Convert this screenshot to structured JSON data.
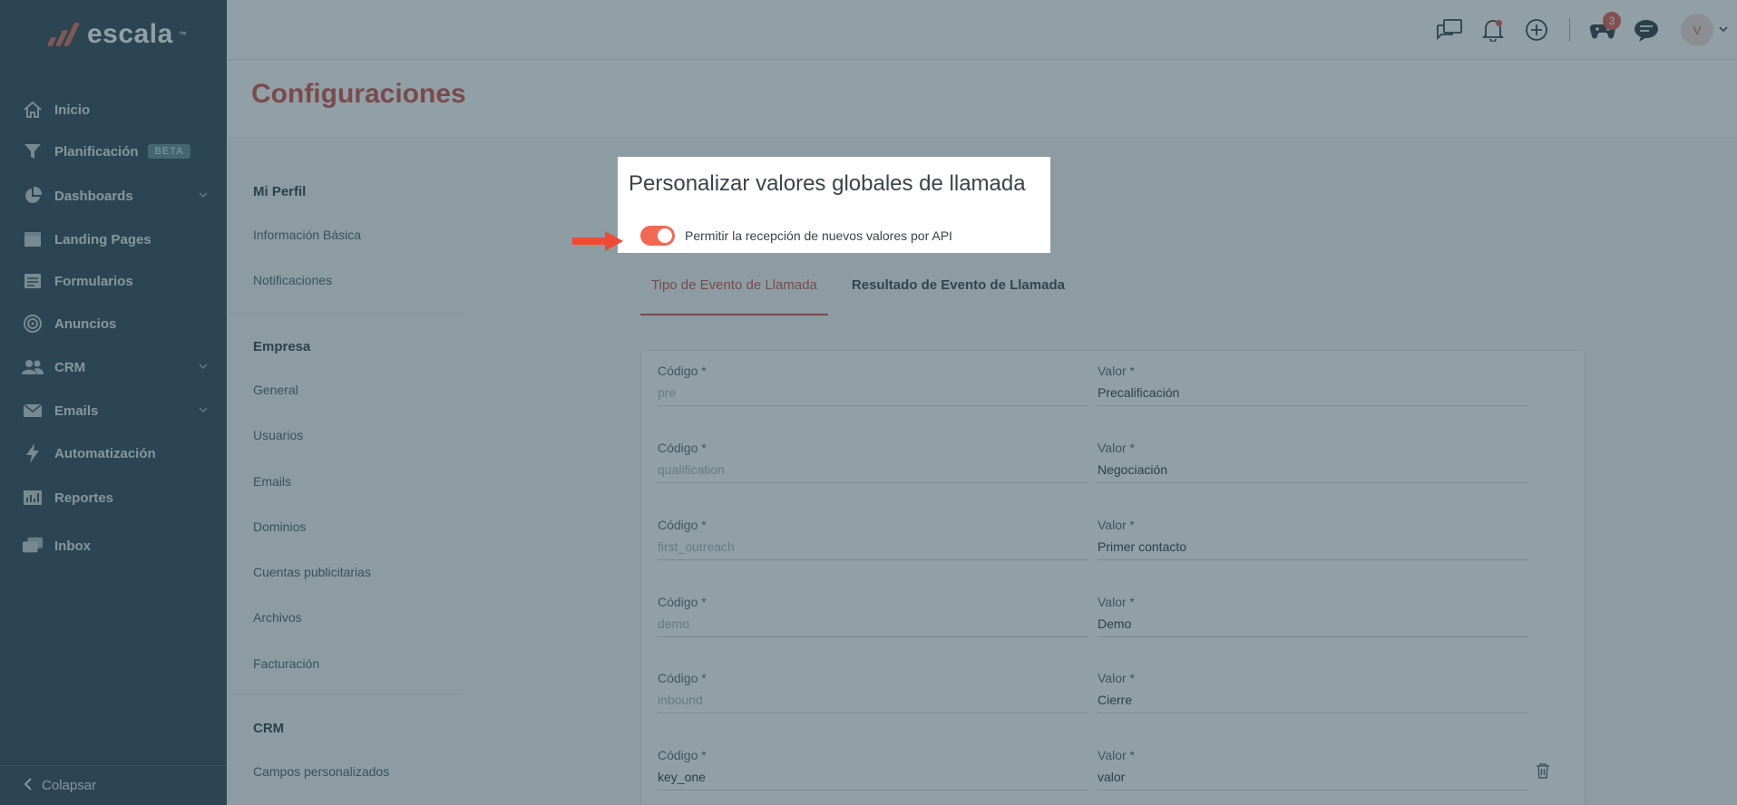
{
  "brand": {
    "name": "escala",
    "accent": "#e06a5a",
    "sidebar_bg": "#2c4352"
  },
  "sidebar": {
    "items": [
      {
        "label": "Inicio",
        "icon": "home-icon"
      },
      {
        "label": "Planificación",
        "icon": "filter-icon",
        "badge": "BETA"
      },
      {
        "label": "Dashboards",
        "icon": "pie-chart-icon",
        "expandable": true
      },
      {
        "label": "Landing Pages",
        "icon": "browser-window-icon"
      },
      {
        "label": "Formularios",
        "icon": "form-icon"
      },
      {
        "label": "Anuncios",
        "icon": "target-icon"
      },
      {
        "label": "CRM",
        "icon": "people-icon",
        "expandable": true
      },
      {
        "label": "Emails",
        "icon": "mail-icon",
        "expandable": true
      },
      {
        "label": "Automatización",
        "icon": "lightning-icon"
      },
      {
        "label": "Reportes",
        "icon": "report-icon"
      },
      {
        "label": "Inbox",
        "icon": "inbox-icon"
      }
    ],
    "collapse_label": "Colapsar"
  },
  "topbar": {
    "notifications_badge": "3",
    "avatar_initial": "V"
  },
  "page": {
    "title": "Configuraciones"
  },
  "settings_nav": {
    "sections": [
      {
        "title": "Mi Perfil",
        "items": [
          "Información Básica",
          "Notificaciones"
        ]
      },
      {
        "title": "Empresa",
        "items": [
          "General",
          "Usuarios",
          "Emails",
          "Dominios",
          "Cuentas publicitarias",
          "Archivos",
          "Facturación"
        ]
      },
      {
        "title": "CRM",
        "items": [
          "Campos personalizados"
        ]
      }
    ]
  },
  "panel": {
    "title": "Personalizar valores globales de llamada",
    "toggle_label": "Permitir la recepción de nuevos valores por API",
    "toggle_on": true
  },
  "tabs": [
    {
      "label": "Tipo de Evento de Llamada",
      "active": true
    },
    {
      "label": "Resultado de Evento de Llamada",
      "active": false
    }
  ],
  "form": {
    "code_label": "Código *",
    "value_label": "Valor *",
    "rows": [
      {
        "code": "pre",
        "code_is_placeholder": true,
        "value": "Precalificación"
      },
      {
        "code": "qualification",
        "code_is_placeholder": true,
        "value": "Negociación"
      },
      {
        "code": "first_outreach",
        "code_is_placeholder": true,
        "value": "Primer contacto"
      },
      {
        "code": "demo",
        "code_is_placeholder": true,
        "value": "Demo"
      },
      {
        "code": "inbound",
        "code_is_placeholder": true,
        "value": "Cierre"
      },
      {
        "code": "key_one",
        "code_is_placeholder": false,
        "value": "valor",
        "deletable": true
      }
    ]
  }
}
